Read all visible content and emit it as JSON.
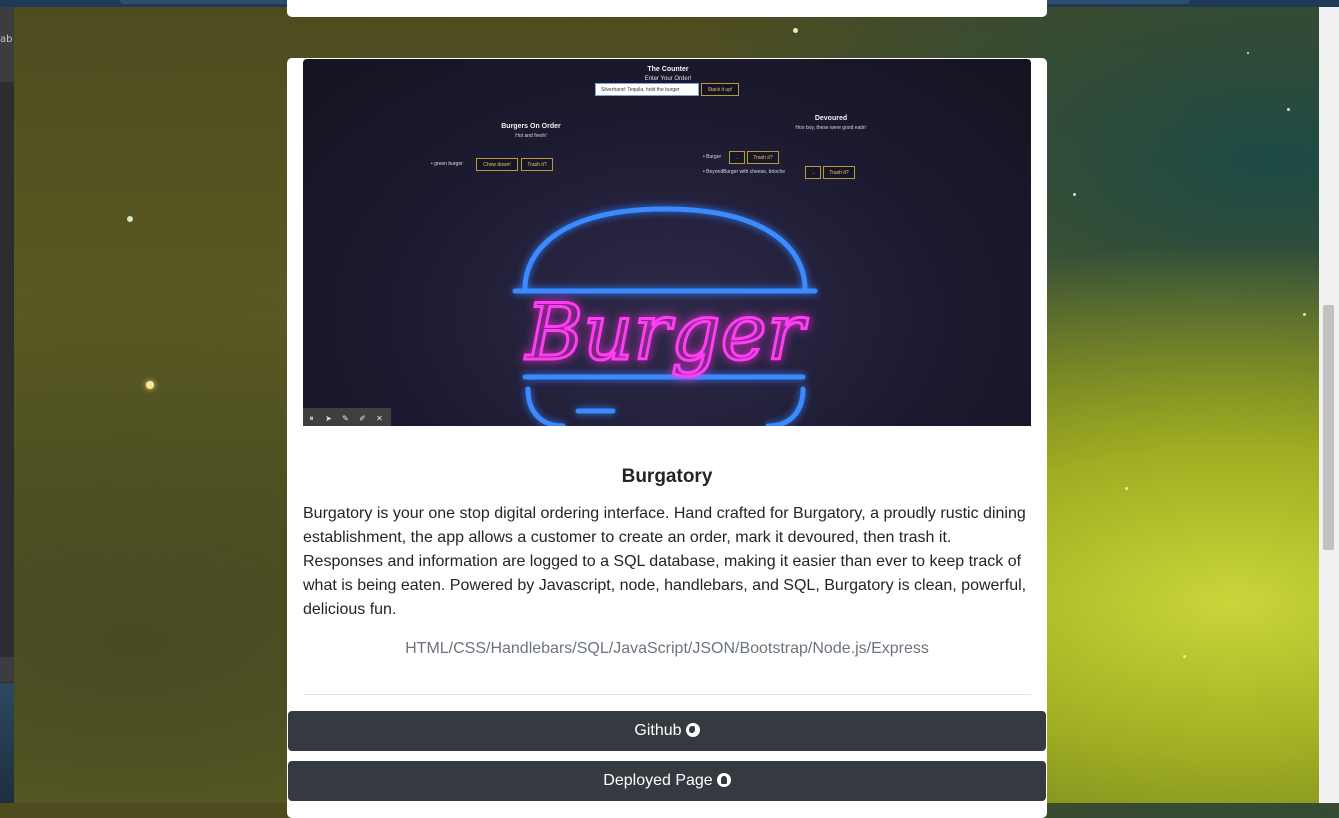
{
  "browser": {
    "left_panel_text": "ab"
  },
  "screenshot": {
    "header_title": "The Counter",
    "header_subtitle": "Enter Your Order!",
    "input_value": "Silverhand: Tequila, hold the burger",
    "stack_button": "Stack it up!",
    "on_order_title": "Burgers On Order",
    "on_order_subtitle": "Hot and fresh!",
    "on_order_item": "green burger",
    "chow_button": "Chow down!",
    "trash_button": "Trash it?",
    "devoured_title": "Devoured",
    "devoured_subtitle": "Hoo boy, these were good eatin'",
    "devoured_item_1": "Burger",
    "devoured_item_2": "BeyondBurger with cheese, brioche",
    "arrow_button": "→",
    "neon_text": "Burger",
    "controls": [
      "⏸",
      "➤",
      "✎",
      "✐",
      "✕"
    ]
  },
  "project": {
    "title": "Burgatory",
    "description": "Burgatory is your one stop digital ordering interface. Hand crafted for Burgatory, a proudly rustic dining establishment, the app allows a customer to create an order, mark it devoured, then trash it. Responses and information are logged to a SQL database, making it easier than ever to keep track of what is being eaten. Powered by Javascript, node, handlebars, and SQL, Burgatory is clean, powerful, delicious fun.",
    "tech": "HTML/CSS/Handlebars/SQL/JavaScript/JSON/Bootstrap/Node.js/Express",
    "github_label": "Github",
    "github_icon": "globe-icon",
    "deployed_label": "Deployed Page",
    "deployed_icon": "github-icon"
  },
  "colors": {
    "button_dark": "#343a40",
    "muted_text": "#6c757d",
    "neon_pink": "#ff3df2",
    "neon_blue": "#3b8bff"
  }
}
